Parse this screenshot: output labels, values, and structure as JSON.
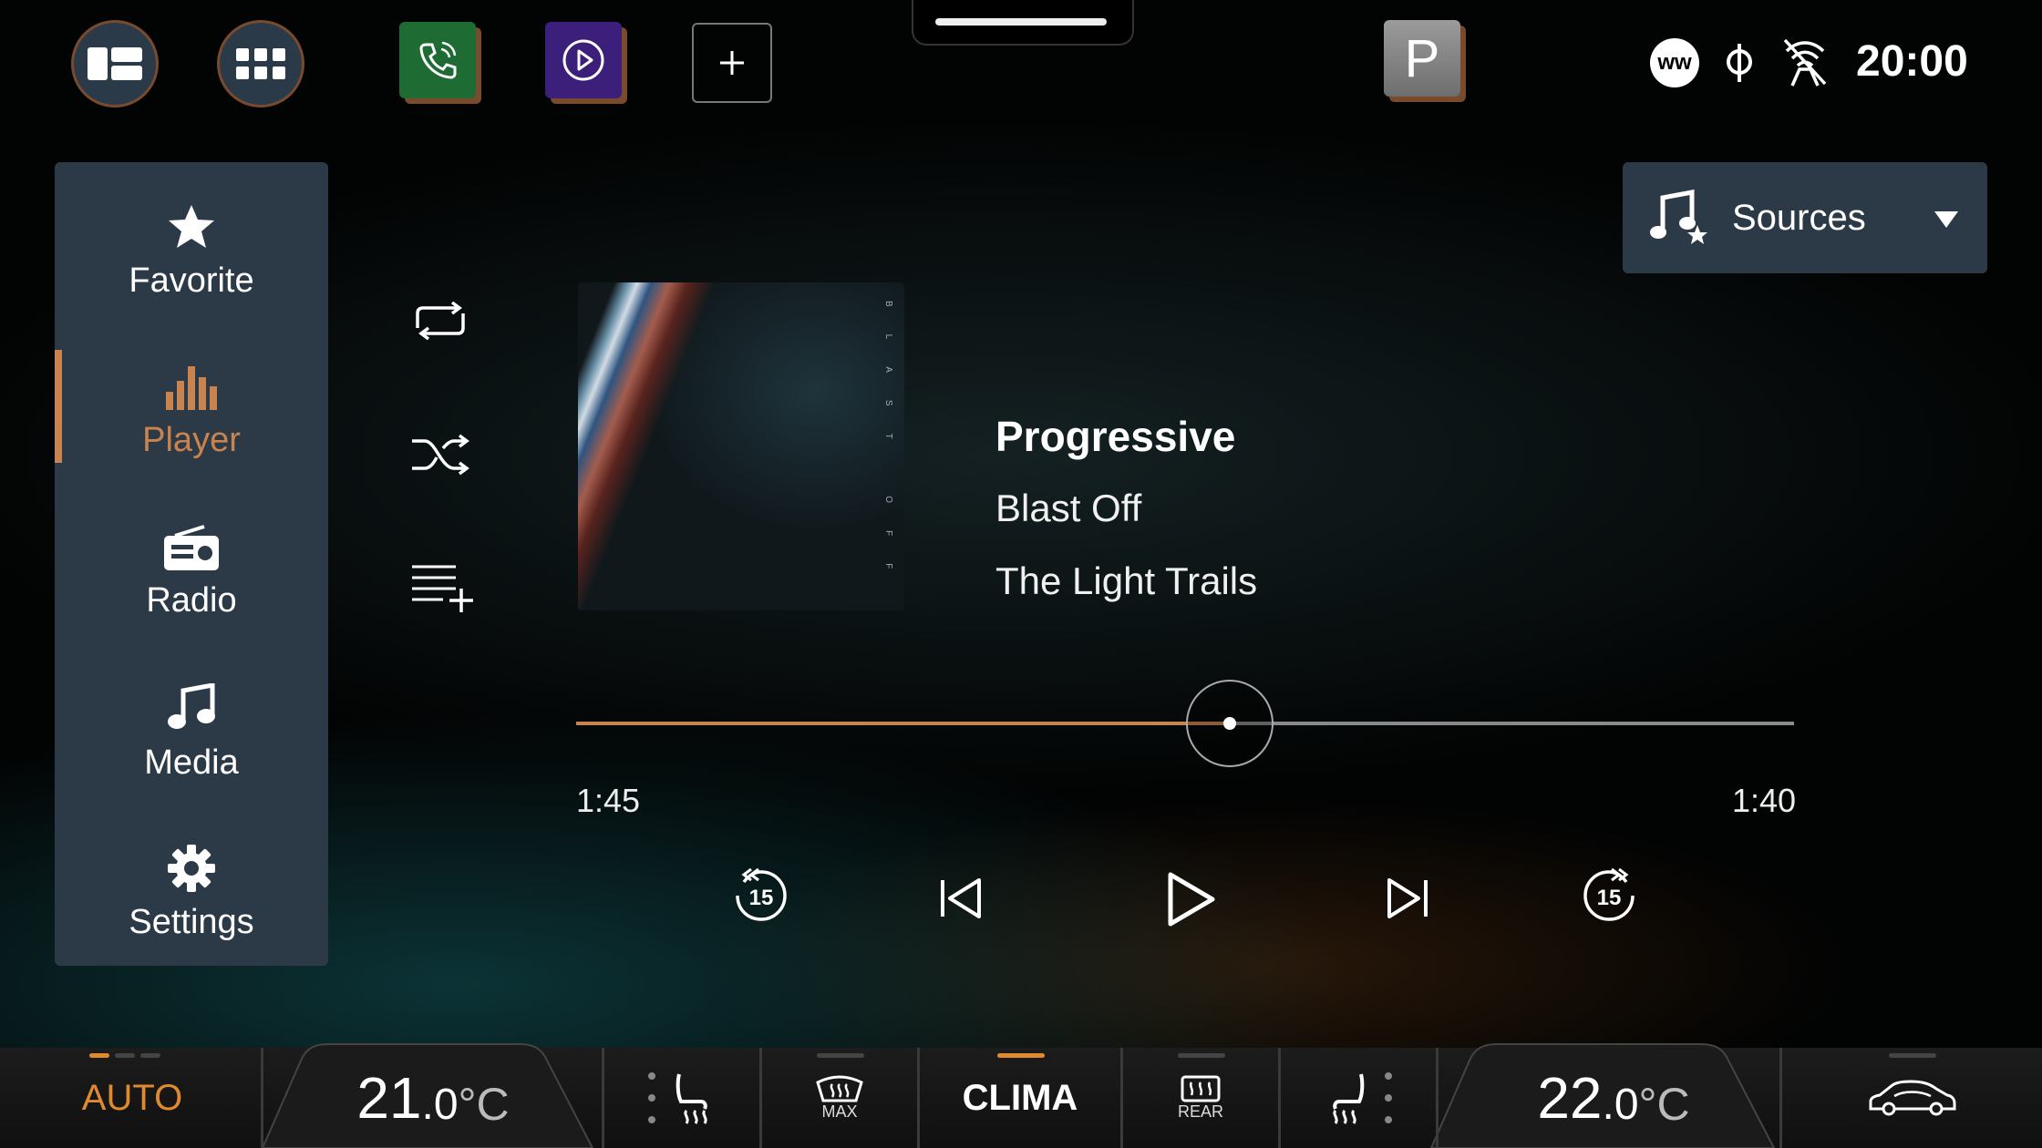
{
  "status": {
    "clock": "20:00",
    "ww_badge": "ww",
    "park_label": "P"
  },
  "sidebar": {
    "items": [
      {
        "label": "Favorite",
        "icon": "star-icon"
      },
      {
        "label": "Player",
        "icon": "equalizer-icon",
        "active": true
      },
      {
        "label": "Radio",
        "icon": "radio-icon"
      },
      {
        "label": "Media",
        "icon": "music-note-icon"
      },
      {
        "label": "Settings",
        "icon": "gear-icon"
      }
    ]
  },
  "sources": {
    "label": "Sources"
  },
  "track": {
    "title": "Progressive",
    "album": "Blast Off",
    "artist": "The Light Trails",
    "album_art_text": "BLAST OFF",
    "elapsed": "1:45",
    "remaining": "1:40",
    "progress": 0.537
  },
  "climate": {
    "auto_label": "AUTO",
    "left_temp": "21",
    "left_temp_dec": ".0",
    "left_unit": "°C",
    "max_label": "MAX",
    "clima_label": "CLIMA",
    "rear_label": "REAR",
    "right_temp": "22",
    "right_temp_dec": ".0",
    "right_unit": "°C"
  },
  "colors": {
    "accent": "#c9834f",
    "panel": "#2c3a48",
    "phone_tile": "#1e6b34",
    "media_tile": "#3b1f7a"
  }
}
